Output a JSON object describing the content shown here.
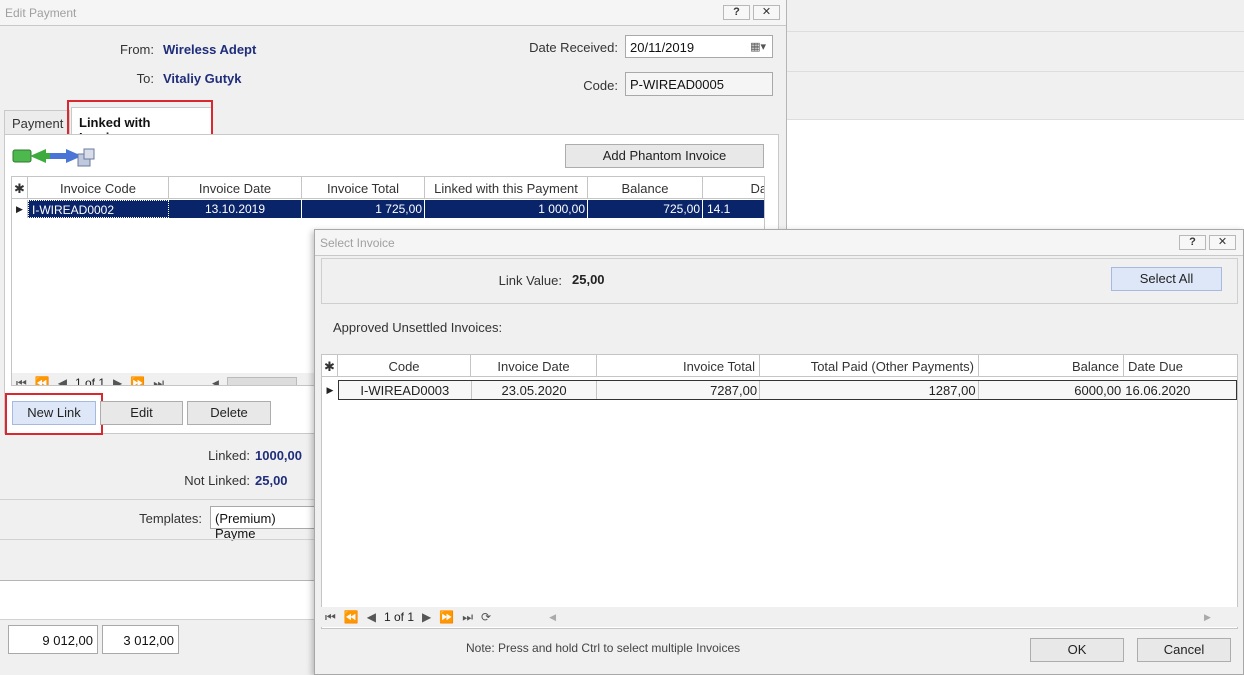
{
  "edit_payment": {
    "title": "Edit Payment",
    "help_btn": "?",
    "close_btn": "✕",
    "from_label": "From:",
    "from_value": "Wireless Adept",
    "to_label": "To:",
    "to_value": "Vitaliy Gutyk",
    "date_label": "Date Received:",
    "date_value": "20/11/2019",
    "code_label": "Code:",
    "code_value": "P-WIREAD0005",
    "tabs": [
      "Payment",
      "Linked with Invoices"
    ],
    "add_phantom": "Add Phantom Invoice",
    "columns": [
      "Invoice Code",
      "Invoice Date",
      "Invoice Total",
      "Linked with this Payment",
      "Balance",
      "Date"
    ],
    "row": [
      "I-WIREAD0002",
      "13.10.2019",
      "1 725,00",
      "1 000,00",
      "725,00",
      "14.1"
    ],
    "pager": "1 of 1",
    "new_link": "New Link",
    "edit": "Edit",
    "delete": "Delete",
    "linked_label": "Linked:",
    "linked_value": "1000,00",
    "not_linked_label": "Not Linked:",
    "not_linked_value": "25,00",
    "templates_label": "Templates:",
    "templates_value": "(Premium) Payme",
    "total1": "9 012,00",
    "total2": "3 012,00"
  },
  "select_invoice": {
    "title": "Select Invoice",
    "help_btn": "?",
    "close_btn": "✕",
    "link_value_label": "Link Value:",
    "link_value": "25,00",
    "select_all": "Select All",
    "section_label": "Approved Unsettled Invoices:",
    "columns": [
      "Code",
      "Invoice Date",
      "Invoice Total",
      "Total Paid (Other Payments)",
      "Balance",
      "Date Due"
    ],
    "row": [
      "I-WIREAD0003",
      "23.05.2020",
      "7287,00",
      "1287,00",
      "6000,00",
      "16.06.2020"
    ],
    "pager": "1 of 1",
    "note": "Note: Press and hold Ctrl to select multiple Invoices",
    "ok": "OK",
    "cancel": "Cancel"
  },
  "colors": {
    "selected_row": "#0a246a",
    "highlight_red": "#d9282f",
    "value_text": "#1f2d7a"
  }
}
